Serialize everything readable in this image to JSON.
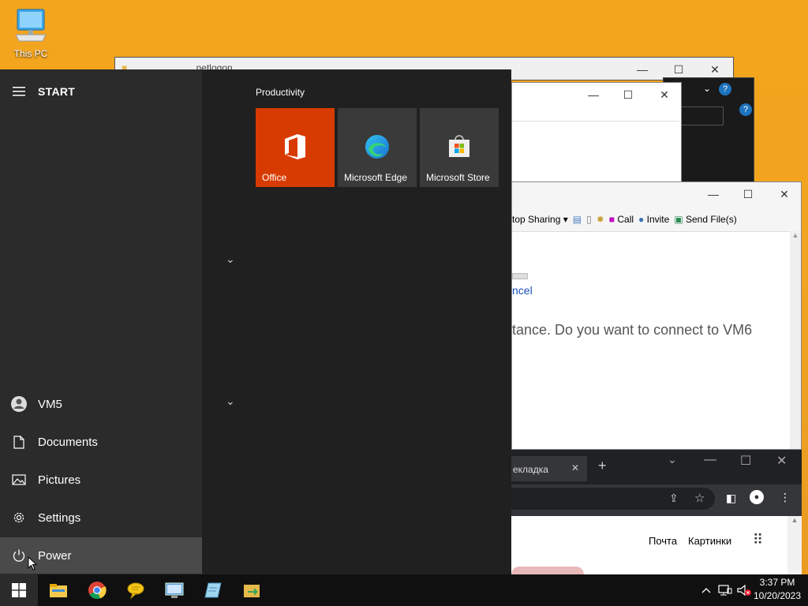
{
  "desktop": {
    "this_pc_label": "This PC"
  },
  "windows": {
    "explorer_title": "netlogon",
    "chat_toolbar": {
      "desktop_sharing": "top Sharing",
      "call": "Call",
      "invite": "Invite",
      "send_files": "Send File(s)"
    },
    "chat_link": "ncel",
    "chat_message": "tance. Do you want to connect to VM6",
    "browser_tab_label": "екладка",
    "browser_links": {
      "mail": "Почта",
      "images": "Картинки"
    }
  },
  "start_menu": {
    "title": "START",
    "group_title": "Productivity",
    "tiles": [
      {
        "label": "Office",
        "bg": "#d83b01"
      },
      {
        "label": "Microsoft Edge",
        "bg": "#3a3a3a"
      },
      {
        "label": "Microsoft Store",
        "bg": "#3a3a3a"
      }
    ],
    "rail": {
      "user": "VM5",
      "documents": "Documents",
      "pictures": "Pictures",
      "settings": "Settings",
      "power": "Power"
    }
  },
  "taskbar": {
    "apps": [
      "file-explorer-icon",
      "chrome-icon",
      "chat-icon",
      "remote-desktop-icon",
      "notepad-icon",
      "transfer-icon"
    ],
    "time": "3:37 PM",
    "date": "10/20/2023"
  }
}
